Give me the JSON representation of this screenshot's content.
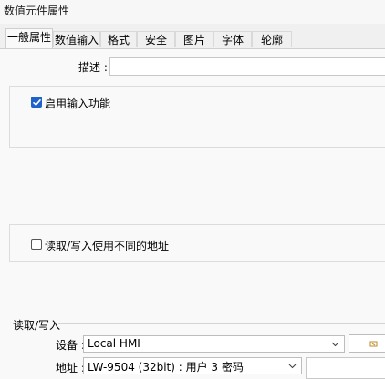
{
  "window": {
    "title": "数值元件属性"
  },
  "tabs": [
    {
      "label": "一般属性",
      "active": true
    },
    {
      "label": "数值输入",
      "active": false
    },
    {
      "label": "格式",
      "active": false
    },
    {
      "label": "安全",
      "active": false
    },
    {
      "label": "图片",
      "active": false
    },
    {
      "label": "字体",
      "active": false
    },
    {
      "label": "轮廓",
      "active": false
    }
  ],
  "general": {
    "description_label": "描述 :",
    "description_value": ""
  },
  "input_panel": {
    "enable_input_label": "启用输入功能",
    "enable_input_checked": true
  },
  "address_panel": {
    "diff_address_label": "读取/写入使用不同的地址",
    "diff_address_checked": false
  },
  "rw_group": {
    "title": "读取/写入",
    "device_label": "设备 :",
    "device_value": "Local HMI",
    "address_label": "地址 :",
    "address_value": "LW-9504 (32bit) : 用户 3 密码"
  },
  "colors": {
    "accent": "#1f63c8",
    "background": "#f0f0f0",
    "content_bg": "#f9f9f9"
  }
}
